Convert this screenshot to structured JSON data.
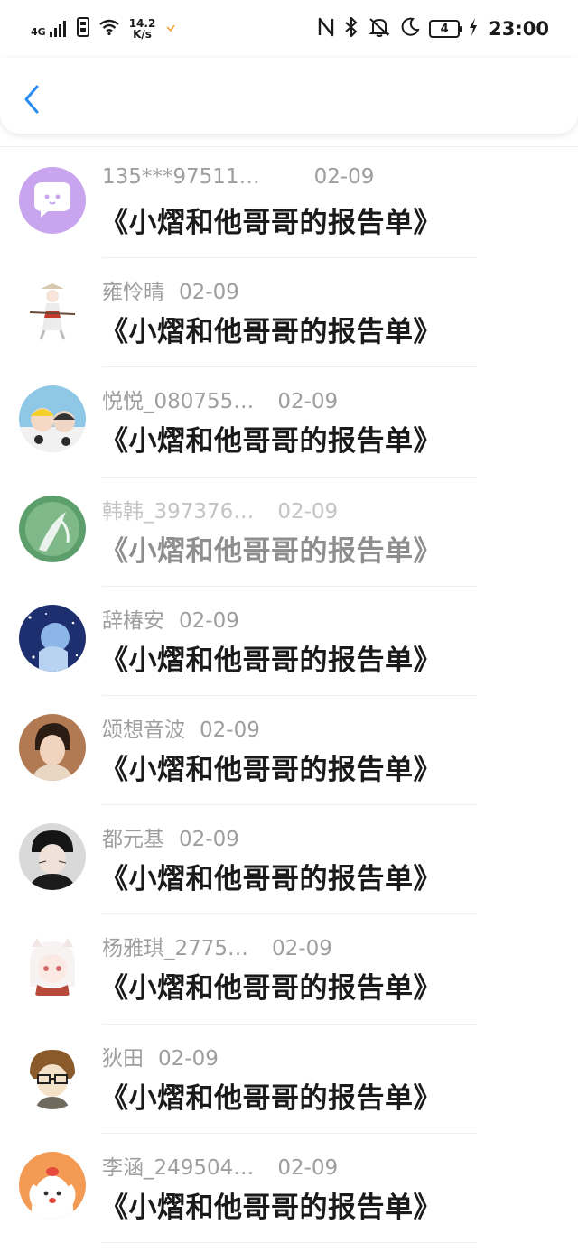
{
  "status_bar": {
    "network": "4G",
    "speed_value": "14.2",
    "speed_unit": "K/s",
    "battery": "4",
    "time": "23:00"
  },
  "nav": {
    "back_icon": "chevron-left-icon",
    "accent": "#2a8cf0"
  },
  "list": {
    "items": [
      {
        "user": "135***97511…",
        "date": "02-09",
        "title": "《小熠和他哥哥的报告单》",
        "avatar_color": "#c9a4ef"
      },
      {
        "user": "雍怜晴",
        "date": "02-09",
        "title": "《小熠和他哥哥的报告单》",
        "avatar_color": "#f3efe9"
      },
      {
        "user": "悦悦_080755…",
        "date": "02-09",
        "title": "《小熠和他哥哥的报告单》",
        "avatar_color": "#8fc7e6"
      },
      {
        "user": "韩韩_397376…",
        "date": "02-09",
        "title": "《小熠和他哥哥的报告单》",
        "avatar_color": "#5c9e6c"
      },
      {
        "user": "辞椿安",
        "date": "02-09",
        "title": "《小熠和他哥哥的报告单》",
        "avatar_color": "#1d2f6e"
      },
      {
        "user": "颂想音波",
        "date": "02-09",
        "title": "《小熠和他哥哥的报告单》",
        "avatar_color": "#b27a52"
      },
      {
        "user": "都元基",
        "date": "02-09",
        "title": "《小熠和他哥哥的报告单》",
        "avatar_color": "#2c2c2c"
      },
      {
        "user": "杨雅琪_2775…",
        "date": "02-09",
        "title": "《小熠和他哥哥的报告单》",
        "avatar_color": "#f4e6e2"
      },
      {
        "user": "狄田",
        "date": "02-09",
        "title": "《小熠和他哥哥的报告单》",
        "avatar_color": "#f6f2ea"
      },
      {
        "user": "李涵_249504…",
        "date": "02-09",
        "title": "《小熠和他哥哥的报告单》",
        "avatar_color": "#f39a55"
      }
    ]
  }
}
